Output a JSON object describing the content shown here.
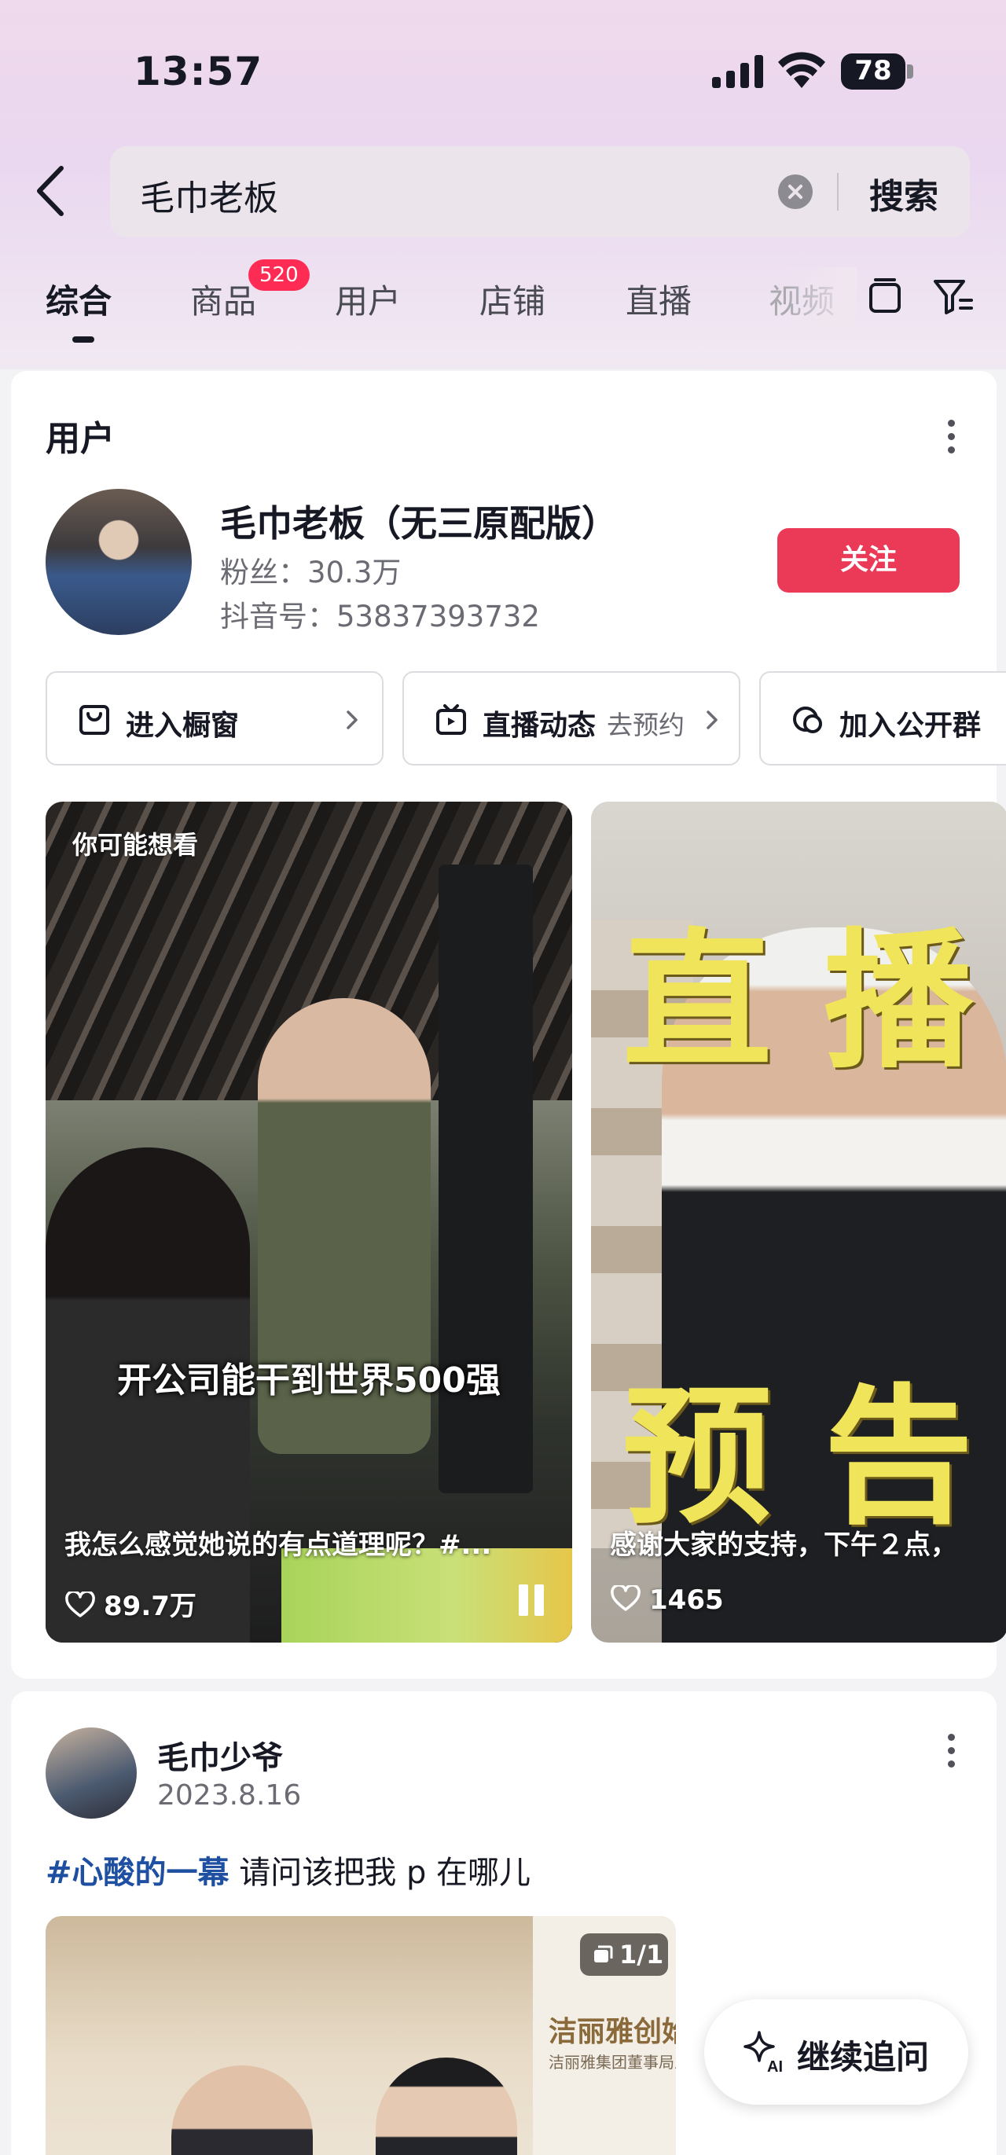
{
  "status_bar": {
    "time": "13:57",
    "battery": "78"
  },
  "search": {
    "query": "毛巾老板",
    "button": "搜索"
  },
  "tabs": [
    {
      "label": "综合",
      "active": true
    },
    {
      "label": "商品",
      "badge": "520"
    },
    {
      "label": "用户"
    },
    {
      "label": "店铺"
    },
    {
      "label": "直播"
    },
    {
      "label": "视频"
    }
  ],
  "user_section": {
    "title": "用户",
    "name": "毛巾老板（无三原配版）",
    "fans": "粉丝：30.3万",
    "douyin_id": "抖音号：53837393732",
    "follow": "关注",
    "actions": [
      {
        "label": "进入橱窗"
      },
      {
        "label": "直播动态",
        "sub": "去预约"
      },
      {
        "label": "加入公开群"
      }
    ],
    "videos": [
      {
        "tag": "你可能想看",
        "subtitle": "开公司能干到世界500强",
        "caption": "我怎么感觉她说的有点道理呢？#...",
        "likes": "89.7万"
      },
      {
        "overlay_top": "直 播",
        "overlay_bottom": "预 告",
        "caption": "感谢大家的支持，下午２点，",
        "likes": "1465"
      }
    ]
  },
  "post": {
    "author": "毛巾少爷",
    "date": "2023.8.16",
    "hashtag": "#心酸的一幕",
    "text": " 请问该把我 p 在哪儿",
    "image_count": "1/1",
    "poster_title": "洁丽雅创始",
    "poster_sub": "洁丽雅集团董事局主席"
  },
  "ai_button": {
    "label": "继续追问",
    "icon_text": "AI"
  },
  "colors": {
    "accent": "#ea3a58",
    "badge": "#fe2c55",
    "hashtag": "#1e4fa0"
  }
}
